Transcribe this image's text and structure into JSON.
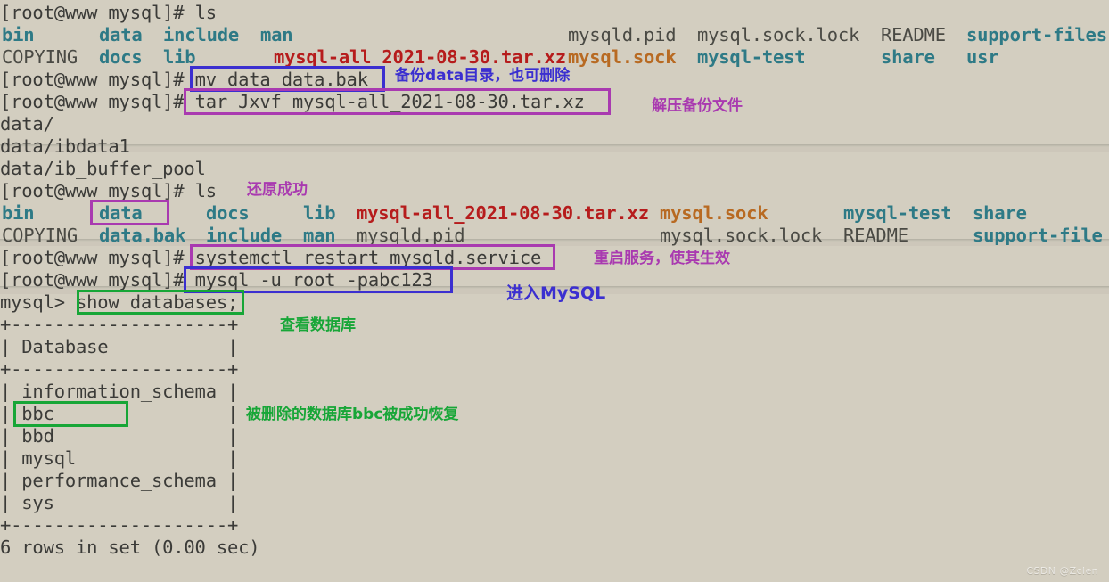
{
  "terminal": {
    "prompt": "[root@www mysql]# ",
    "mysql_prompt": "mysql> ",
    "background_color": "#d3cec0",
    "text_color": "#3b3b38",
    "dir_color": "#2e7a86",
    "archive_color": "#b61c1c",
    "socket_color": "#b86a22"
  },
  "lines": {
    "l01_cmd": "ls",
    "ls1_row1": {
      "bin": "bin",
      "data": "data",
      "include": "include",
      "man": "man",
      "mysqld_pid": "mysqld.pid",
      "mysql_sock_lock": "mysql.sock.lock",
      "readme": "README",
      "support_files": "support-files"
    },
    "ls1_row2": {
      "copying": "COPYING",
      "docs": "docs",
      "lib": "lib",
      "archive": "mysql-all_2021-08-30.tar.xz",
      "mysql_sock": "mysql.sock",
      "mysql_test": "mysql-test",
      "share": "share",
      "usr": "usr"
    },
    "cmd_mv": "mv data data.bak",
    "cmd_tar": "tar Jxvf mysql-all_2021-08-30.tar.xz",
    "tar_out1": "data/",
    "tar_out2": "data/ibdata1",
    "tar_out3": "data/ib_buffer_pool",
    "l02_cmd": "ls",
    "ls2_row1": {
      "bin": "bin",
      "data": "data",
      "docs": "docs",
      "lib": "lib",
      "archive": "mysql-all_2021-08-30.tar.xz",
      "mysql_sock": "mysql.sock",
      "mysql_test": "mysql-test",
      "share": "share"
    },
    "ls2_row2": {
      "copying": "COPYING",
      "data_bak": "data.bak",
      "include": "include",
      "man": "man",
      "mysqld_pid": "mysqld.pid",
      "mysql_sock_lock": "mysql.sock.lock",
      "readme": "README",
      "support_files": "support-file"
    },
    "cmd_systemctl": "systemctl restart mysqld.service",
    "cmd_mysql_login": "mysql -u root -pabc123",
    "cmd_show_databases": "show databases;"
  },
  "db_table": {
    "border_top": "+--------------------+",
    "header": "| Database           |",
    "border_mid": "+--------------------+",
    "rows": [
      "| information_schema |",
      "| bbc                |",
      "| bbd                |",
      "| mysql              |",
      "| performance_schema |",
      "| sys                |"
    ],
    "border_bottom": "+--------------------+",
    "footer": "6 rows in set (0.00 sec)"
  },
  "annotations": {
    "mv_note": "备份data目录，也可删除",
    "tar_note": "解压备份文件",
    "restore_note": "还原成功",
    "restart_note": "重启服务，使其生效",
    "login_note": "进入MySQL",
    "show_db_note": "查看数据库",
    "bbc_note": "被删除的数据库bbc被成功恢复"
  },
  "watermark": "CSDN @Zclen"
}
